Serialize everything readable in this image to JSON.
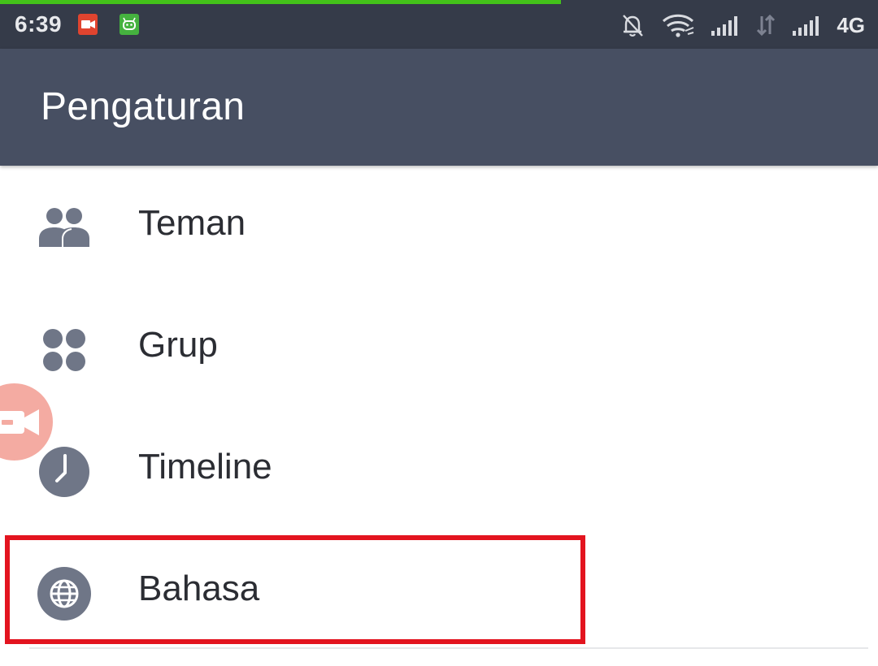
{
  "status_bar": {
    "time": "6:39",
    "network": "4G",
    "notifications": [
      "screen-recorder-icon",
      "android-app-icon"
    ],
    "icons": [
      "silent-bell-icon",
      "wifi-icon",
      "signal-icon-sim1",
      "data-transfer-icon",
      "signal-icon-sim2"
    ]
  },
  "app_bar": {
    "title": "Pengaturan"
  },
  "settings": {
    "items": [
      {
        "label": "Teman",
        "icon": "friends-icon"
      },
      {
        "label": "Grup",
        "icon": "group-icon"
      },
      {
        "label": "Timeline",
        "icon": "clock-icon"
      },
      {
        "label": "Bahasa",
        "icon": "globe-icon",
        "highlighted": true
      }
    ]
  },
  "colors": {
    "status_bar": "#353b49",
    "app_bar": "#474f62",
    "icon": "#6f7687",
    "highlight": "#e3141f",
    "progress": "#43c21a"
  }
}
